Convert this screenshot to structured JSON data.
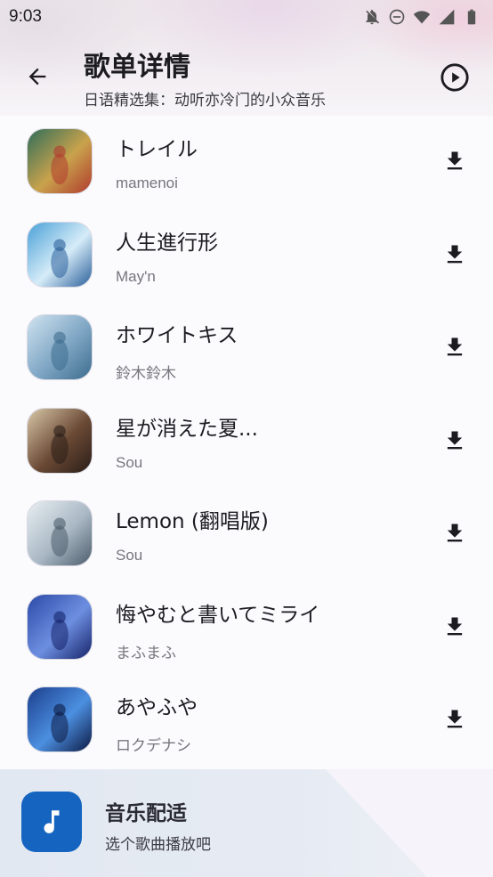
{
  "status_bar": {
    "time": "9:03",
    "icons": [
      "notifications-off-icon",
      "do-not-disturb-icon",
      "wifi-icon",
      "cellular-icon",
      "battery-icon"
    ]
  },
  "header": {
    "title": "歌单详情",
    "subtitle": "日语精选集：动听亦冷门的小众音乐",
    "back_icon": "arrow-back-icon",
    "play_icon": "play-circle-icon"
  },
  "songs": [
    {
      "title": "トレイル",
      "artist": "mamenoi",
      "cover_colors": [
        "#2f6e5a",
        "#c9a24c",
        "#b03b2e"
      ]
    },
    {
      "title": "人生進行形",
      "artist": "May'n",
      "cover_colors": [
        "#4aa0d8",
        "#d6ecf8",
        "#2a5f9a"
      ]
    },
    {
      "title": "ホワイトキス",
      "artist": "鈴木鈴木",
      "cover_colors": [
        "#cfe3f0",
        "#7fa6c4",
        "#3d6c8e"
      ]
    },
    {
      "title": "星が消えた夏...",
      "artist": "Sou",
      "cover_colors": [
        "#d8c7a8",
        "#6b4a35",
        "#2a1d18"
      ]
    },
    {
      "title": "Lemon (翻唱版)",
      "artist": "Sou",
      "cover_colors": [
        "#e8eef2",
        "#a9b8c4",
        "#4d5d6c"
      ]
    },
    {
      "title": "悔やむと書いてミライ",
      "artist": "まふまふ",
      "cover_colors": [
        "#2c4aa8",
        "#6d8fe0",
        "#16236a"
      ]
    },
    {
      "title": "あやふや",
      "artist": "ロクデナシ",
      "cover_colors": [
        "#1b3e8c",
        "#4c8fe0",
        "#0c1a44"
      ]
    }
  ],
  "player": {
    "title": "音乐配适",
    "subtitle": "选个歌曲播放吧",
    "icon": "music-note-icon",
    "accent": "#1565c0"
  }
}
